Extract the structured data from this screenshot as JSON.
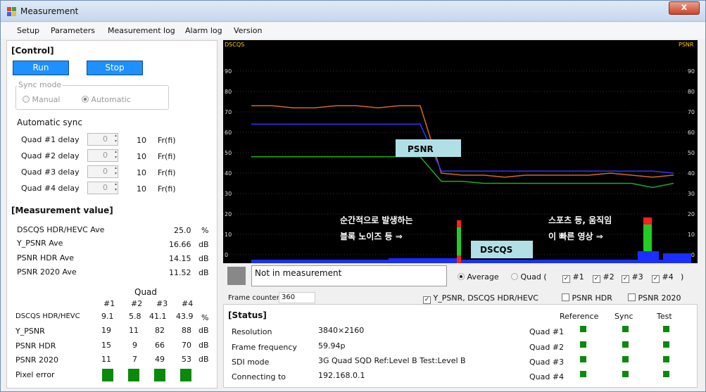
{
  "window": {
    "title": "Measurement",
    "close_label": "x"
  },
  "menu": [
    "Setup",
    "Parameters",
    "Measurement log",
    "Alarm log",
    "Version"
  ],
  "control": {
    "heading": "[Control]",
    "run_label": "Run",
    "stop_label": "Stop",
    "sync_mode_label": "Sync mode",
    "manual_label": "Manual",
    "automatic_label": "Automatic",
    "sync_mode_selected": "Automatic"
  },
  "auto_sync": {
    "heading": "Automatic sync",
    "rows": [
      {
        "label": "Quad #1 delay",
        "value": "0",
        "frames": "10",
        "unit": "Fr(fi)"
      },
      {
        "label": "Quad #2 delay",
        "value": "0",
        "frames": "10",
        "unit": "Fr(fi)"
      },
      {
        "label": "Quad #3 delay",
        "value": "0",
        "frames": "10",
        "unit": "Fr(fi)"
      },
      {
        "label": "Quad #4 delay",
        "value": "0",
        "frames": "10",
        "unit": "Fr(fi)"
      }
    ]
  },
  "measurement": {
    "heading": "[Measurement value]",
    "rows": [
      {
        "label": "DSCQS HDR/HEVC Ave",
        "value": "25.0",
        "unit": "%"
      },
      {
        "label": "Y_PSNR Ave",
        "value": "16.66",
        "unit": "dB"
      },
      {
        "label": "PSNR HDR Ave",
        "value": "14.15",
        "unit": "dB"
      },
      {
        "label": "PSNR 2020 Ave",
        "value": "11.52",
        "unit": "dB"
      }
    ],
    "quad_label": "Quad",
    "quad_cols": [
      "#1",
      "#2",
      "#3",
      "#4"
    ],
    "quad_rows": [
      {
        "label": "DSCQS HDR/HEVC",
        "values": [
          "9.1",
          "5.8",
          "41.1",
          "43.9"
        ],
        "unit": "%"
      },
      {
        "label": "Y_PSNR",
        "values": [
          "19",
          "11",
          "82",
          "88"
        ],
        "unit": "dB"
      },
      {
        "label": "PSNR HDR",
        "values": [
          "15",
          "9",
          "66",
          "70"
        ],
        "unit": "dB"
      },
      {
        "label": "PSNR 2020",
        "values": [
          "11",
          "7",
          "49",
          "53"
        ],
        "unit": "dB"
      }
    ],
    "pixel_error_label": "Pixel error"
  },
  "chart_data": {
    "type": "line",
    "left_axis_label": "DSCQS",
    "right_axis_label": "PSNR",
    "yticks": [
      0,
      10,
      20,
      30,
      40,
      50,
      60,
      70,
      80,
      90
    ],
    "ylim": [
      0,
      100
    ],
    "x": [
      0,
      5,
      10,
      15,
      20,
      25,
      30,
      35,
      40,
      45,
      50,
      55,
      60,
      65,
      70,
      75,
      80,
      85,
      90,
      95,
      100
    ],
    "series": [
      {
        "color": "#d2691e",
        "values": [
          73,
          73,
          72,
          72,
          73,
          73,
          72,
          73,
          73,
          40,
          39,
          39,
          38,
          39,
          39,
          39,
          39,
          40,
          39,
          38,
          39
        ]
      },
      {
        "color": "#3333ff",
        "values": [
          64,
          64,
          64,
          64,
          64,
          64,
          64,
          64,
          64,
          41,
          41,
          41,
          41,
          41,
          41,
          41,
          41,
          41,
          41,
          41,
          40
        ]
      },
      {
        "color": "#22aa22",
        "values": [
          48,
          48,
          48,
          48,
          48,
          48,
          48,
          48,
          48,
          36,
          36,
          35,
          35,
          35,
          35,
          35,
          35,
          35,
          35,
          33,
          35
        ]
      }
    ],
    "annotations": [
      {
        "label": "PSNR"
      },
      {
        "label": "DSCQS"
      },
      {
        "text": "순간적으로 발생하는"
      },
      {
        "text": "블록 노이즈 등   ⇒"
      },
      {
        "text": "스포츠 등, 움직임"
      },
      {
        "text": "이 빠른 영상   ⇒"
      }
    ]
  },
  "status_bar": {
    "message": "Not in measurement",
    "average_label": "Average",
    "quad_label": "Quad (",
    "quad_checks": [
      "#1",
      "#2",
      "#3",
      "#4"
    ],
    "close_paren": ")",
    "frame_counter_label": "Frame counter",
    "frame_counter_value": "360",
    "chk_ypsnr": "Y_PSNR, DSCQS HDR/HEVC",
    "chk_psnr_hdr": "PSNR HDR",
    "chk_psnr_2020": "PSNR 2020",
    "ypsnr_checked": true,
    "psnr_hdr_checked": false,
    "psnr_2020_checked": false
  },
  "status": {
    "heading": "[Status]",
    "col_headers": [
      "Reference",
      "Sync",
      "Test"
    ],
    "rows": [
      {
        "label": "Resolution",
        "value": "3840×2160",
        "quad": "Quad #1"
      },
      {
        "label": "Frame frequency",
        "value": "59.94p",
        "quad": "Quad #2"
      },
      {
        "label": "SDI mode",
        "value": "3G Quad  SQD  Ref:Level B Test:Level B",
        "quad": "Quad #3"
      },
      {
        "label": "Connecting to",
        "value": "192.168.0.1",
        "quad": "Quad #4"
      }
    ],
    "indicator_color": "#0a8a0a"
  }
}
